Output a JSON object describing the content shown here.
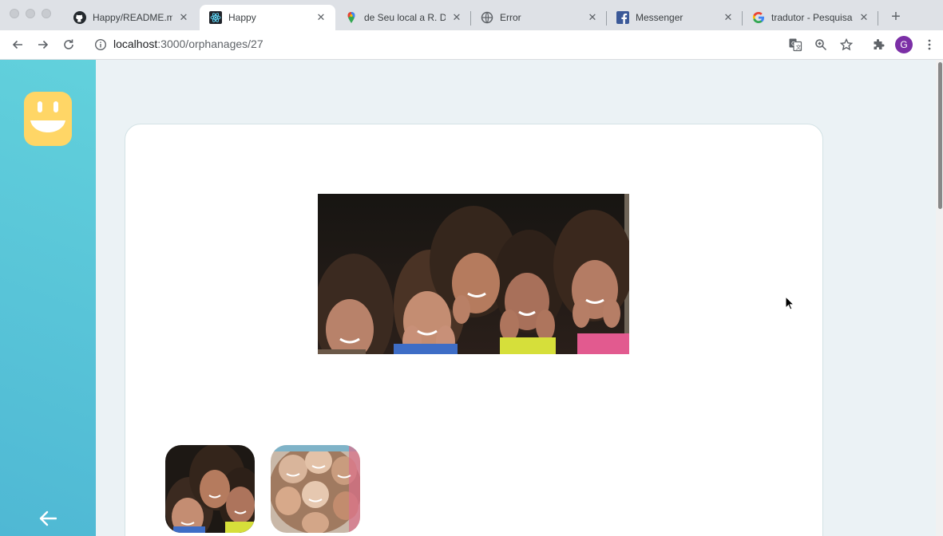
{
  "browser": {
    "tabs": [
      {
        "title": "Happy/README.md",
        "icon": "github-icon"
      },
      {
        "title": "Happy",
        "icon": "react-icon",
        "active": true
      },
      {
        "title": "de Seu local a R. D",
        "icon": "google-maps-icon"
      },
      {
        "title": "Error",
        "icon": "globe-icon"
      },
      {
        "title": "Messenger",
        "icon": "facebook-icon"
      },
      {
        "title": "tradutor - Pesquisa",
        "icon": "google-icon"
      }
    ],
    "url_host": "localhost",
    "url_path": ":3000/orphanages/27",
    "profile_initial": "G"
  },
  "app": {
    "brand_color": "#15c3d6",
    "logo_color": "#ffd666",
    "main_image": "children-photo",
    "thumbnails": [
      "children-photo-thumbnail",
      "children-circle-photo-thumbnail"
    ]
  }
}
